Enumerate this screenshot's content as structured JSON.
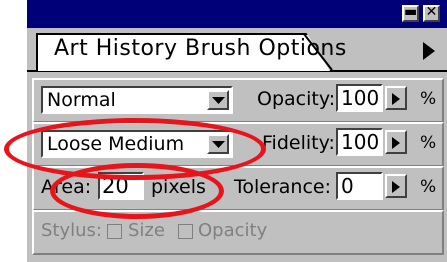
{
  "panel": {
    "tab_title": "Art History Brush Options",
    "minimize_glyph": "▬",
    "close_glyph": "✕"
  },
  "row1": {
    "mode_value": "Normal",
    "opacity_label": "Opacity:",
    "opacity_value": "100",
    "opacity_unit": "%"
  },
  "row2": {
    "style_value": "Loose Medium",
    "fidelity_label": "Fidelity:",
    "fidelity_value": "100",
    "fidelity_unit": "%"
  },
  "row3": {
    "area_label": "Area:",
    "area_value": "20",
    "area_unit": "pixels",
    "tolerance_label": "Tolerance:",
    "tolerance_value": "0",
    "tolerance_unit": "%"
  },
  "row4": {
    "stylus_label": "Stylus:",
    "size_label": "Size",
    "opacity_label": "Opacity"
  },
  "colors": {
    "titlebar": "#000078",
    "panel": "#c0c0c0",
    "annotation": "#e8141c"
  },
  "icons": {
    "minimize": "minimize-icon",
    "close": "close-icon",
    "menu_arrow": "triangle-right-icon",
    "dropdown": "chevron-down-icon"
  }
}
